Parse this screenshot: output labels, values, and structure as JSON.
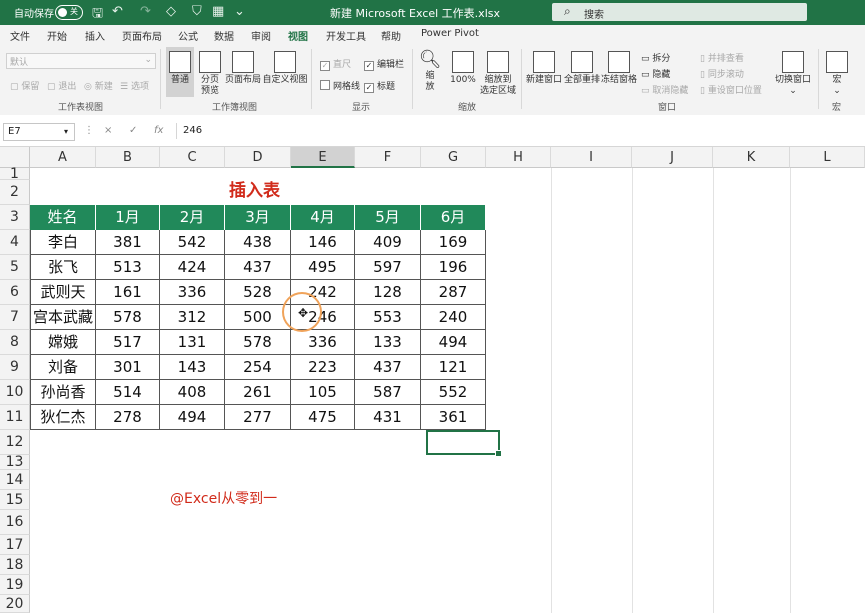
{
  "titlebar": {
    "autosave_label": "自动保存",
    "autosave_state": "关",
    "document_title": "新建 Microsoft Excel 工作表.xlsx",
    "search_placeholder": "搜索"
  },
  "menu": {
    "tabs": [
      "文件",
      "开始",
      "插入",
      "页面布局",
      "公式",
      "数据",
      "审阅",
      "视图",
      "开发工具",
      "帮助",
      "Power Pivot"
    ],
    "active_tab": "视图"
  },
  "ribbon": {
    "sheet_view": {
      "dropdown_value": "默认",
      "keep": "保留",
      "exit": "退出",
      "new": "新建",
      "options": "选项",
      "label": "工作表视图"
    },
    "workbook_views": {
      "normal": "普通",
      "page_break_line1": "分页",
      "page_break_line2": "预览",
      "page_layout": "页面布局",
      "custom_views": "自定义视图",
      "label": "工作簿视图"
    },
    "show": {
      "ruler": "直尺",
      "formula_bar": "编辑栏",
      "gridlines": "网格线",
      "headings": "标题",
      "label": "显示"
    },
    "zoom": {
      "zoom_line1": "缩",
      "zoom_line2": "放",
      "zoom_100": "100%",
      "zoom_selection_line1": "缩放到",
      "zoom_selection_line2": "选定区域",
      "label": "缩放"
    },
    "window": {
      "new_window": "新建窗口",
      "arrange_all": "全部重排",
      "freeze_panes": "冻结窗格",
      "split": "拆分",
      "hide": "隐藏",
      "unhide": "取消隐藏",
      "view_side_by_side": "并排查看",
      "sync_scrolling": "同步滚动",
      "reset_window_position": "重设窗口位置",
      "label": "窗口"
    },
    "switch_windows": "切换窗口",
    "macros": {
      "macro": "宏",
      "label": "宏"
    }
  },
  "formula_bar": {
    "name_box": "E7",
    "cancel": "×",
    "enter": "✓",
    "fx": "fx",
    "value": "246"
  },
  "columns": [
    "A",
    "B",
    "C",
    "D",
    "E",
    "F",
    "G",
    "H",
    "I",
    "J",
    "K",
    "L"
  ],
  "selected_column": "E",
  "rows": [
    "1",
    "2",
    "3",
    "4",
    "5",
    "6",
    "7",
    "8",
    "9",
    "10",
    "11",
    "12",
    "13",
    "14",
    "15",
    "16",
    "17",
    "18",
    "19",
    "20"
  ],
  "sheet": {
    "title": "插入表",
    "headers": [
      "姓名",
      "1月",
      "2月",
      "3月",
      "4月",
      "5月",
      "6月"
    ],
    "data": [
      [
        "李白",
        "381",
        "542",
        "438",
        "146",
        "409",
        "169"
      ],
      [
        "张飞",
        "513",
        "424",
        "437",
        "495",
        "597",
        "196"
      ],
      [
        "武则天",
        "161",
        "336",
        "528",
        "242",
        "128",
        "287"
      ],
      [
        "宫本武藏",
        "578",
        "312",
        "500",
        "246",
        "553",
        "240"
      ],
      [
        "嫦娥",
        "517",
        "131",
        "578",
        "336",
        "133",
        "494"
      ],
      [
        "刘备",
        "301",
        "143",
        "254",
        "223",
        "437",
        "121"
      ],
      [
        "孙尚香",
        "514",
        "408",
        "261",
        "105",
        "587",
        "552"
      ],
      [
        "狄仁杰",
        "278",
        "494",
        "277",
        "475",
        "431",
        "361"
      ]
    ],
    "watermark": "@Excel从零到一"
  },
  "colors": {
    "excel_green": "#217346",
    "header_fill": "#21895a",
    "title_red": "#d12b1b"
  }
}
